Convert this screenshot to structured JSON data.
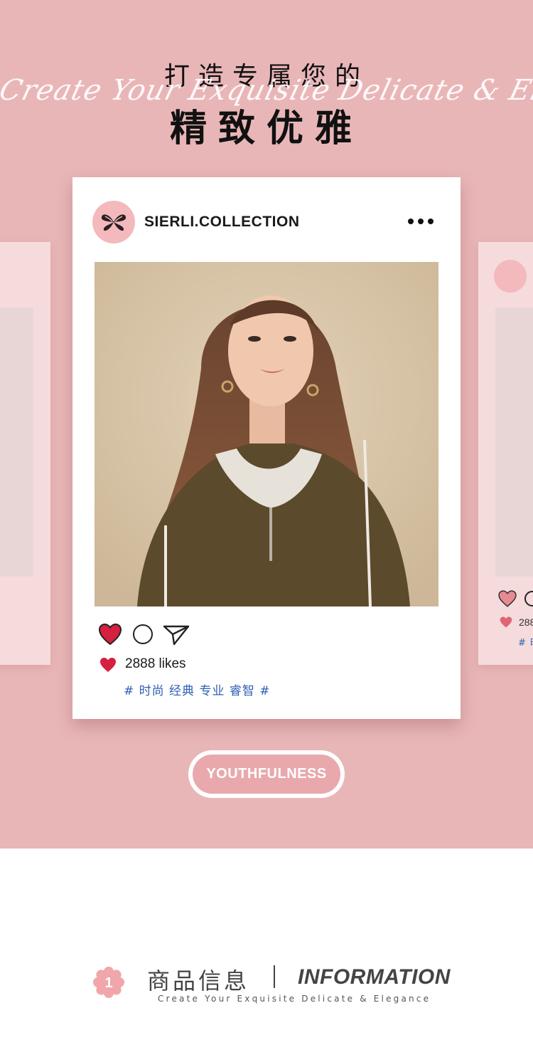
{
  "hero": {
    "title_line1": "打造专属您的",
    "script_text": "Create Your Exquisite Delicate & Elegance",
    "title_line2": "精致优雅",
    "background_color": "#e9b6b8"
  },
  "post": {
    "brand": "SIERLI.COLLECTION",
    "more_icon": "more-dots-icon",
    "logo_icon": "brand-butterfly-logo",
    "likes_text": "2888 likes",
    "tags_text": "# 时尚 经典 专业 睿智 #",
    "photo_alt": "model photo",
    "heart_color": "#d6203f",
    "tag_color": "#2f5fb3"
  },
  "side_post": {
    "likes_text": "288",
    "tags_text": "# 时"
  },
  "pill": {
    "label": "YOUTHFULNESS"
  },
  "info": {
    "badge_number": "1",
    "cn_title": "商品信息",
    "en_title": "INFORMATION",
    "subtitle": "Create Your Exquisite Delicate & Elegance"
  }
}
